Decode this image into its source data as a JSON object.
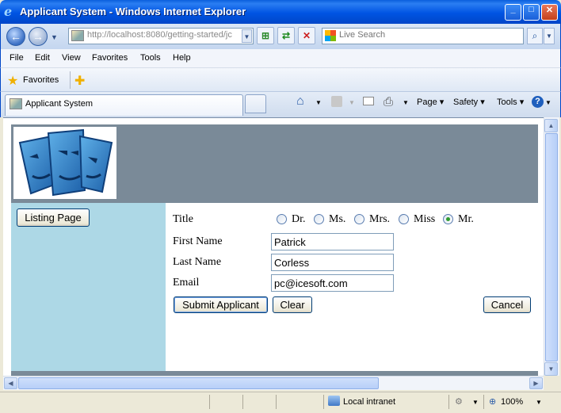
{
  "window": {
    "title": "Applicant System - Windows Internet Explorer"
  },
  "navigation": {
    "address_url": "http://localhost:8080/getting-started/jc",
    "search_placeholder": "Live Search"
  },
  "menu": {
    "items": [
      "File",
      "Edit",
      "View",
      "Favorites",
      "Tools",
      "Help"
    ]
  },
  "favorites_bar": {
    "label": "Favorites"
  },
  "tabs": {
    "active_label": "Applicant System"
  },
  "command_bar": {
    "page": "Page",
    "safety": "Safety",
    "tools": "Tools"
  },
  "sidebar": {
    "listing_button": "Listing Page"
  },
  "form": {
    "title_label": "Title",
    "title_options": [
      "Dr.",
      "Ms.",
      "Mrs.",
      "Miss",
      "Mr."
    ],
    "title_selected": "Mr.",
    "first_name_label": "First Name",
    "first_name_value": "Patrick",
    "last_name_label": "Last Name",
    "last_name_value": "Corless",
    "email_label": "Email",
    "email_value": "pc@icesoft.com",
    "submit_label": "Submit Applicant",
    "clear_label": "Clear",
    "cancel_label": "Cancel"
  },
  "status_bar": {
    "zone": "Local intranet",
    "zoom": "100%"
  },
  "colors": {
    "header_band": "#7a8a98",
    "sidebar": "#add8e6",
    "titlebar": "#0054e3",
    "radio_checked": "#2e9b2e"
  },
  "icons": {
    "browser": "ie-icon",
    "back": "back-arrow-icon",
    "forward": "forward-arrow-icon",
    "refresh": "refresh-icon",
    "stop": "stop-icon",
    "search": "search-icon",
    "home": "home-icon",
    "feeds": "feeds-icon",
    "mail": "mail-icon",
    "print": "print-icon",
    "help": "help-icon",
    "zone": "network-zone-icon",
    "zoom": "zoom-icon"
  }
}
